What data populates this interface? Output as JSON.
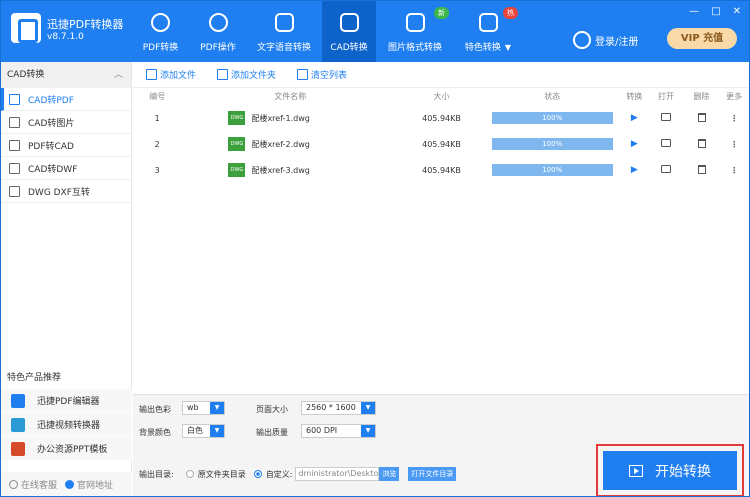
{
  "app": {
    "name": "迅捷PDF转换器",
    "version": "v8.7.1.0"
  },
  "nav": [
    {
      "label": "PDF转换",
      "icon": "refresh-doc-icon"
    },
    {
      "label": "PDF操作",
      "icon": "gear-doc-icon"
    },
    {
      "label": "文字语音转换",
      "icon": "audio-wave-icon"
    },
    {
      "label": "CAD转换",
      "icon": "cad-download-icon"
    },
    {
      "label": "图片格式转换",
      "icon": "image-icon",
      "badge": "新",
      "badge_color": "#3cb54a"
    },
    {
      "label": "特色转换",
      "icon": "star-box-icon",
      "badge": "热",
      "badge_color": "#e8453c"
    }
  ],
  "window": {
    "min": "—",
    "max": "□",
    "close": "✕"
  },
  "login": "登录/注册",
  "vip": "VIP 充值",
  "sidebar": {
    "header": "CAD转换",
    "items": [
      {
        "label": "CAD转PDF",
        "icon": "pdf-doc-icon"
      },
      {
        "label": "CAD转图片",
        "icon": "image-icon"
      },
      {
        "label": "PDF转CAD",
        "icon": "doc-icon"
      },
      {
        "label": "CAD转DWF",
        "icon": "doc-icon"
      },
      {
        "label": "DWG DXF互转",
        "icon": "doc-icon"
      }
    ],
    "promo_title": "特色产品推荐",
    "promo": [
      {
        "label": "迅捷PDF编辑器",
        "color": "#1f7ff0"
      },
      {
        "label": "迅捷视频转换器",
        "color": "#2a9ad6"
      },
      {
        "label": "办公资源PPT模板",
        "color": "#d64a2a"
      }
    ],
    "footer": {
      "service": "在线客服",
      "site": "官网地址"
    }
  },
  "toolbar": {
    "add_file": "添加文件",
    "add_folder": "添加文件夹",
    "clear": "清空列表"
  },
  "table": {
    "headers": {
      "no": "编号",
      "name": "文件名称",
      "size": "大小",
      "status": "状态",
      "convert": "转换",
      "open": "打开",
      "delete": "删除",
      "more": "更多"
    },
    "rows": [
      {
        "no": "1",
        "name": "配楼xref-1.dwg",
        "size": "405.94KB",
        "progress": "100%"
      },
      {
        "no": "2",
        "name": "配楼xref-2.dwg",
        "size": "405.94KB",
        "progress": "100%"
      },
      {
        "no": "3",
        "name": "配楼xref-3.dwg",
        "size": "405.94KB",
        "progress": "100%"
      }
    ],
    "file_badge": "DWG",
    "play": "▶",
    "more": "⋮"
  },
  "settings": {
    "color_label": "输出色彩",
    "color_value": "wb",
    "bg_label": "背景颜色",
    "bg_value": "白色",
    "page_label": "页面大小",
    "page_value": "2560 * 1600",
    "quality_label": "输出质量",
    "quality_value": "600 DPI",
    "output_label": "输出目录:",
    "opt_source": "原文件夹目录",
    "opt_custom": "自定义:",
    "path": "dministrator\\Desktop",
    "browse": "浏览",
    "open_dir": "打开文件目录"
  },
  "start": "开始转换"
}
